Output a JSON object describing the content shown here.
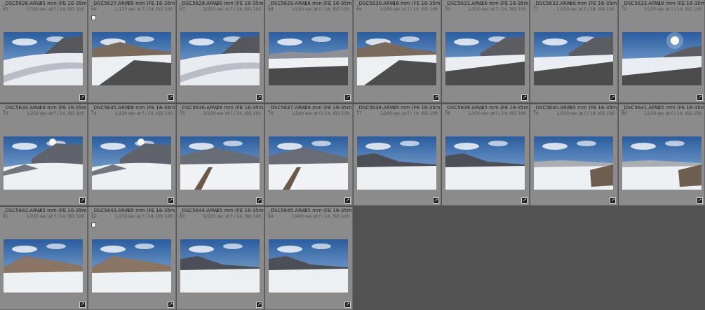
{
  "thumbnails": [
    {
      "name": "_DSC5626.ARW",
      "lens": "35 mm (FE 16-35mm...",
      "index": "65",
      "exposure": "1/320 sec at f / 14, ISO 100",
      "flag": false,
      "scene": "rocky-road"
    },
    {
      "name": "_DSC5627.ARW",
      "lens": "35 mm (FE 16-35mm...",
      "index": "66",
      "exposure": "1/125 sec at f / 14, ISO 100",
      "flag": true,
      "scene": "road-cliff"
    },
    {
      "name": "_DSC5628.ARW",
      "lens": "35 mm (FE 16-35mm...",
      "index": "67",
      "exposure": "1/320 sec at f / 14, ISO 100",
      "flag": false,
      "scene": "rocky-road"
    },
    {
      "name": "_DSC5629.ARW",
      "lens": "16 mm (FE 16-35mm...",
      "index": "68",
      "exposure": "1/200 sec at f / 14, ISO 100",
      "flag": false,
      "scene": "wide-road"
    },
    {
      "name": "_DSC5630.ARW",
      "lens": "16 mm (FE 16-35mm...",
      "index": "69",
      "exposure": "1/200 sec at f / 14, ISO 100",
      "flag": false,
      "scene": "road-cliff"
    },
    {
      "name": "_DSC5631.ARW",
      "lens": "16 mm (FE 16-35mm...",
      "index": "70",
      "exposure": "1/250 sec at f / 14, ISO 100",
      "flag": false,
      "scene": "road-peak"
    },
    {
      "name": "_DSC5632.ARW",
      "lens": "16 mm (FE 16-35mm...",
      "index": "71",
      "exposure": "1/250 sec at f / 14, ISO 100",
      "flag": false,
      "scene": "road-peak"
    },
    {
      "name": "_DSC5633.ARW",
      "lens": "16 mm (FE 16-35mm...",
      "index": "72",
      "exposure": "1/250 sec at f / 14, ISO 100",
      "flag": false,
      "scene": "sun-road"
    },
    {
      "name": "_DSC5634.ARW",
      "lens": "28 mm (FE 16-35mm...",
      "index": "73",
      "exposure": "1/250 sec at f / 14, ISO 100",
      "flag": false,
      "scene": "sun-peak"
    },
    {
      "name": "_DSC5635.ARW",
      "lens": "28 mm (FE 16-35mm...",
      "index": "74",
      "exposure": "1/320 sec at f / 14, ISO 100",
      "flag": false,
      "scene": "sun-peak"
    },
    {
      "name": "_DSC5636.ARW",
      "lens": "28 mm (FE 16-35mm...",
      "index": "75",
      "exposure": "1/320 sec at f / 14, ISO 100",
      "flag": false,
      "scene": "fence"
    },
    {
      "name": "_DSC5637.ARW",
      "lens": "16 mm (FE 16-35mm...",
      "index": "76",
      "exposure": "1/200 sec at f / 14, ISO 100",
      "flag": false,
      "scene": "fence"
    },
    {
      "name": "_DSC5638.ARW",
      "lens": "35 mm (FE 16-35mm...",
      "index": "77",
      "exposure": "1/200 sec at f / 14, ISO 100",
      "flag": false,
      "scene": "snow-field"
    },
    {
      "name": "_DSC5639.ARW",
      "lens": "35 mm (FE 16-35mm...",
      "index": "78",
      "exposure": "1/200 sec at f / 14, ISO 100",
      "flag": false,
      "scene": "snow-field"
    },
    {
      "name": "_DSC5640.ARW",
      "lens": "35 mm (FE 16-35mm...",
      "index": "79",
      "exposure": "1/320 sec at f / 14, ISO 100",
      "flag": false,
      "scene": "block"
    },
    {
      "name": "_DSC5641.ARW",
      "lens": "25 mm (FE 16-35mm...",
      "index": "80",
      "exposure": "1/250 sec at f / 14, ISO 100",
      "flag": false,
      "scene": "block"
    },
    {
      "name": "_DSC5642.ARW",
      "lens": "35 mm (FE 16-35mm...",
      "index": "81",
      "exposure": "1/250 sec at f / 14, ISO 100",
      "flag": false,
      "scene": "hill"
    },
    {
      "name": "_DSC5643.ARW",
      "lens": "35 mm (FE 16-35mm...",
      "index": "82",
      "exposure": "1/250 sec at f / 14, ISO 100",
      "flag": true,
      "scene": "hill"
    },
    {
      "name": "_DSC5644.ARW",
      "lens": "35 mm (FE 16-35mm...",
      "index": "83",
      "exposure": "1/320 sec at f / 14, ISO 100",
      "flag": false,
      "scene": "snow-field"
    },
    {
      "name": "_DSC5645.ARW",
      "lens": "35 mm (FE 16-35mm...",
      "index": "84",
      "exposure": "1/400 sec at f / 14, ISO 100",
      "flag": false,
      "scene": "snow-field"
    }
  ],
  "badge_glyph": "↗",
  "colors": {
    "cell": "#8b8b8b",
    "background": "#525252",
    "sky": "#3d6fae",
    "snow": "#eef1f4",
    "road": "#4a4a4a",
    "rock": "#5b5d63"
  }
}
